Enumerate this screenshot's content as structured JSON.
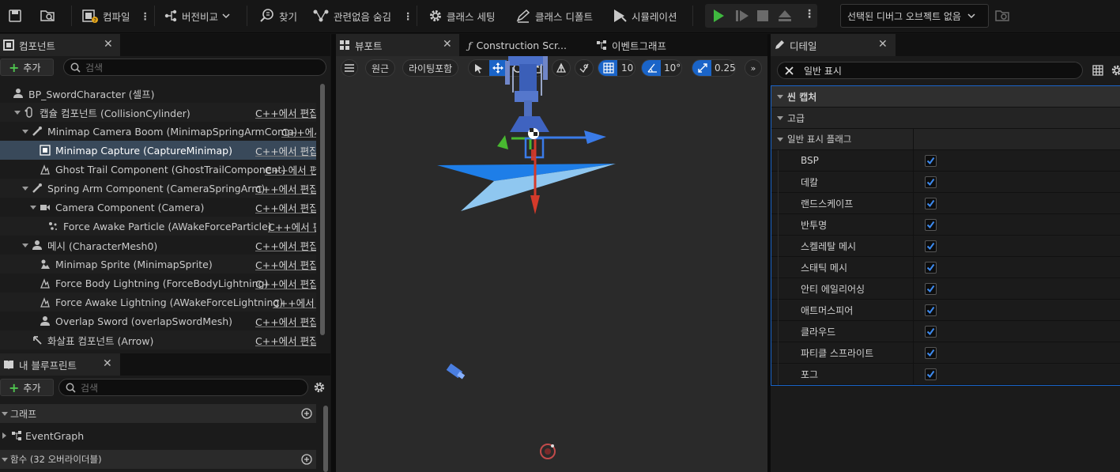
{
  "toolbar": {
    "compile_label": "컴파일",
    "diff_label": "버전비교",
    "find_label": "찾기",
    "hide_unrelated_label": "관련없음 숨김",
    "class_settings_label": "클래스 세팅",
    "class_defaults_label": "클래스 디폴트",
    "simulation_label": "시뮬레이션",
    "debug_object_dropdown": "선택된 디버그 오브젝트 없음"
  },
  "components_panel": {
    "tab_label": "컴포넌트",
    "add_label": "추가",
    "search_placeholder": "검색",
    "tree": [
      {
        "label": "BP_SwordCharacter (셀프)",
        "cpp": ""
      },
      {
        "label": "캡슐 컴포넌트 (CollisionCylinder)",
        "cpp": "C++에서 편집"
      },
      {
        "label": "Minimap Camera Boom (MinimapSpringArmComp)",
        "cpp": "C++에서"
      },
      {
        "label": "Minimap Capture (CaptureMinimap)",
        "cpp": "C++에서 편집"
      },
      {
        "label": "Ghost Trail Component (GhostTrailComponent)",
        "cpp": "C++에서 편집"
      },
      {
        "label": "Spring Arm Component (CameraSpringArm)",
        "cpp": "C++에서 편집"
      },
      {
        "label": "Camera Component (Camera)",
        "cpp": "C++에서 편집"
      },
      {
        "label": "Force Awake Particle (AWakeForceParticle)",
        "cpp": "C++에서 편"
      },
      {
        "label": "메시 (CharacterMesh0)",
        "cpp": "C++에서 편집"
      },
      {
        "label": "Minimap Sprite (MinimapSprite)",
        "cpp": "C++에서 편집"
      },
      {
        "label": "Force Body Lightning (ForceBodyLightning)",
        "cpp": "C++에서 편집"
      },
      {
        "label": "Force Awake Lightning (AWakeForceLightning)",
        "cpp": "C++에서 편"
      },
      {
        "label": "Overlap Sword (overlapSwordMesh)",
        "cpp": "C++에서 편집"
      },
      {
        "label": "화살표 컴포넌트 (Arrow)",
        "cpp": "C++에서 편집"
      }
    ]
  },
  "my_blueprint_panel": {
    "tab_label": "내 블루프린트",
    "add_label": "추가",
    "search_placeholder": "검색",
    "graph_section": "그래프",
    "event_graph": "EventGraph",
    "functions_section": "함수 (32 오버라이더블)"
  },
  "center_tabs": {
    "viewport": "뷰포트",
    "construction": "Construction Scr...",
    "event_graph": "이벤트그래프"
  },
  "viewport_toolbar": {
    "perspective": "원근",
    "lighting": "라이팅포함",
    "grid_snap": "10",
    "rotation_snap": "10°",
    "scale_snap": "0.25"
  },
  "details_panel": {
    "tab_label": "디테일",
    "search_value": "일반 표시",
    "section_scene_capture": "씬 캡처",
    "section_advanced": "고급",
    "section_show_flags": "일반 표시 플래그",
    "flags": [
      {
        "name": "BSP",
        "checked": true
      },
      {
        "name": "데칼",
        "checked": true
      },
      {
        "name": "랜드스케이프",
        "checked": true
      },
      {
        "name": "반투명",
        "checked": true
      },
      {
        "name": "스켈레탈 메시",
        "checked": true
      },
      {
        "name": "스태틱 메시",
        "checked": true
      },
      {
        "name": "안티 에일리어싱",
        "checked": true
      },
      {
        "name": "애트머스피어",
        "checked": true
      },
      {
        "name": "클라우드",
        "checked": true
      },
      {
        "name": "파티클 스프라이트",
        "checked": true
      },
      {
        "name": "포그",
        "checked": true
      }
    ]
  },
  "colors": {
    "accent_blue": "#1a64c8",
    "play_green": "#3fb83f",
    "selection": "#39495a"
  }
}
